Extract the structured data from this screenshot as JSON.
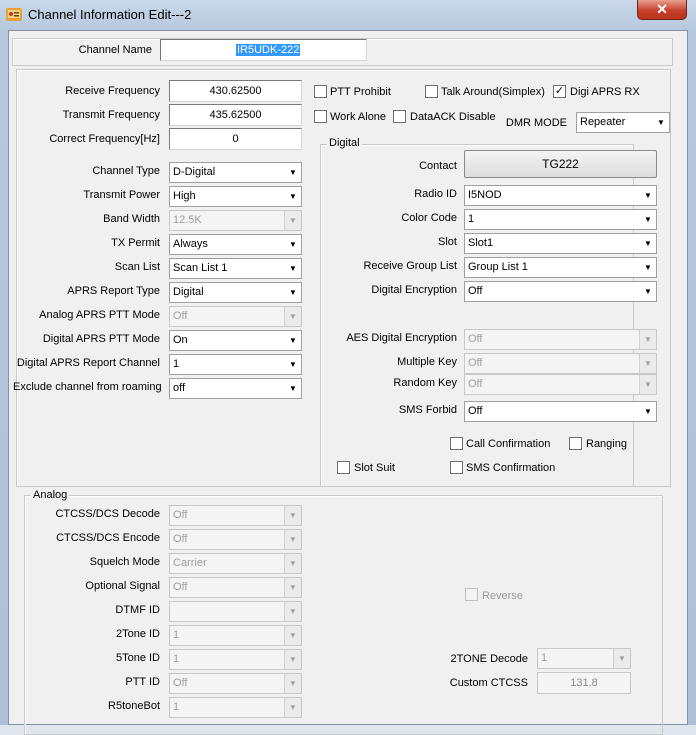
{
  "window": {
    "title": "Channel Information Edit---2",
    "close_glyph": "✕"
  },
  "channel_name": {
    "label": "Channel Name",
    "value": "IR5UDK-222"
  },
  "freq": {
    "receive_label": "Receive Frequency",
    "receive_value": "430.62500",
    "transmit_label": "Transmit Frequency",
    "transmit_value": "435.62500",
    "correct_label": "Correct Frequency[Hz]",
    "correct_value": "0"
  },
  "checks_top": {
    "ptt_prohibit": "PTT Prohibit",
    "talk_around": "Talk Around(Simplex)",
    "digi_aprs_rx": "Digi APRS RX",
    "work_alone": "Work Alone",
    "dataack_disable": "DataACK Disable",
    "check_mark": "✓"
  },
  "dmr_mode": {
    "label": "DMR MODE",
    "value": "Repeater"
  },
  "left_fields": [
    {
      "label": "Channel Type",
      "value": "D-Digital",
      "disabled": false
    },
    {
      "label": "Transmit Power",
      "value": "High",
      "disabled": false
    },
    {
      "label": "Band Width",
      "value": "12.5K",
      "disabled": true
    },
    {
      "label": "TX Permit",
      "value": "Always",
      "disabled": false
    },
    {
      "label": "Scan List",
      "value": "Scan List 1",
      "disabled": false
    },
    {
      "label": "APRS Report Type",
      "value": "Digital",
      "disabled": false
    },
    {
      "label": "Analog APRS PTT Mode",
      "value": "Off",
      "disabled": true
    },
    {
      "label": "Digital APRS PTT Mode",
      "value": "On",
      "disabled": false
    },
    {
      "label": "Digital APRS Report Channel",
      "value": "1",
      "disabled": false
    },
    {
      "label": "Exclude channel from roaming",
      "value": "off",
      "disabled": false
    }
  ],
  "digital": {
    "legend": "Digital",
    "contact_label": "Contact",
    "contact_value": "TG222",
    "radio_id_label": "Radio ID",
    "radio_id_value": "I5NOD",
    "color_code_label": "Color Code",
    "color_code_value": "1",
    "slot_label": "Slot",
    "slot_value": "Slot1",
    "rx_group_label": "Receive Group List",
    "rx_group_value": "Group List 1",
    "encryption_label": "Digital Encryption",
    "encryption_value": "Off",
    "aes_label": "AES Digital Encryption",
    "aes_value": "Off",
    "multiple_key_label": "Multiple Key",
    "multiple_key_value": "Off",
    "random_key_label": "Random Key",
    "random_key_value": "Off",
    "sms_forbid_label": "SMS Forbid",
    "sms_forbid_value": "Off",
    "call_confirmation": "Call Confirmation",
    "ranging": "Ranging",
    "slot_suit": "Slot Suit",
    "sms_confirmation": "SMS Confirmation"
  },
  "analog": {
    "legend": "Analog",
    "fields": [
      {
        "label": "CTCSS/DCS Decode",
        "value": "Off",
        "type": "select"
      },
      {
        "label": "CTCSS/DCS Encode",
        "value": "Off",
        "type": "select"
      },
      {
        "label": "Squelch Mode",
        "value": "Carrier",
        "type": "select"
      },
      {
        "label": "Optional Signal",
        "value": "Off",
        "type": "select"
      },
      {
        "label": "DTMF ID",
        "value": "",
        "type": "select"
      },
      {
        "label": "2Tone ID",
        "value": "1",
        "type": "select"
      },
      {
        "label": "5Tone ID",
        "value": "1",
        "type": "select"
      },
      {
        "label": "PTT ID",
        "value": "Off",
        "type": "select"
      },
      {
        "label": "R5toneBot",
        "value": "1",
        "type": "select"
      }
    ],
    "reverse": "Reverse",
    "two_tone_decode_label": "2TONE Decode",
    "two_tone_decode_value": "1",
    "custom_ctcss_label": "Custom CTCSS",
    "custom_ctcss_value": "131.8"
  },
  "arrow_glyph": "▼"
}
